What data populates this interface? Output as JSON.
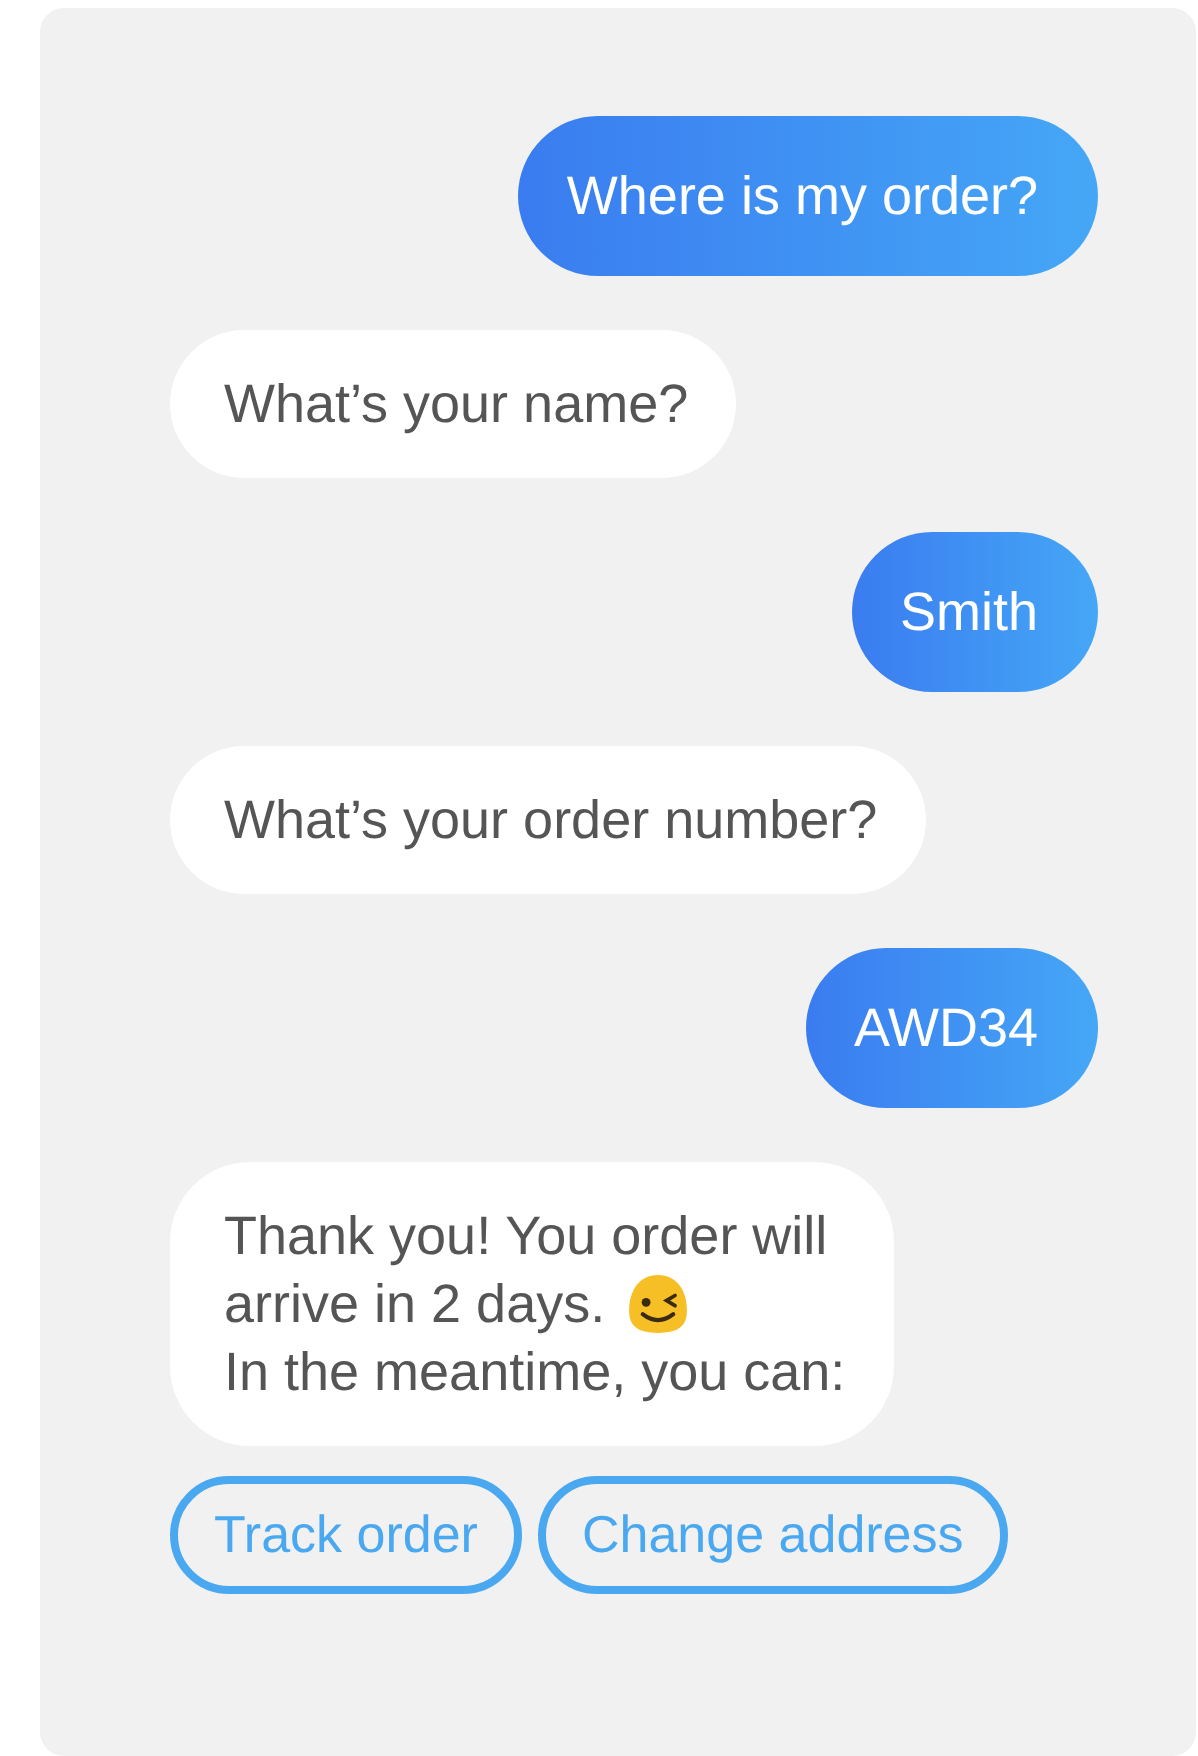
{
  "messages": [
    {
      "kind": "sent",
      "lines": [
        {
          "kind": "text",
          "text": "Where is my order?"
        }
      ]
    },
    {
      "kind": "received",
      "lines": [
        {
          "kind": "text",
          "text": "What’s your name?"
        }
      ]
    },
    {
      "kind": "sent",
      "lines": [
        {
          "kind": "text",
          "text": "Smith"
        }
      ]
    },
    {
      "kind": "received",
      "lines": [
        {
          "kind": "text",
          "text": "What’s your order number?"
        }
      ]
    },
    {
      "kind": "sent",
      "lines": [
        {
          "kind": "text",
          "text": "AWD34"
        }
      ]
    },
    {
      "kind": "received",
      "lines": [
        {
          "kind": "text",
          "text": "Thank you! You order will"
        },
        {
          "kind": "emoji",
          "text": "arrive in 2 days."
        },
        {
          "kind": "text",
          "text": "In the meantime, you can:"
        }
      ]
    }
  ],
  "quick_replies": [
    "Track order",
    "Change address"
  ]
}
